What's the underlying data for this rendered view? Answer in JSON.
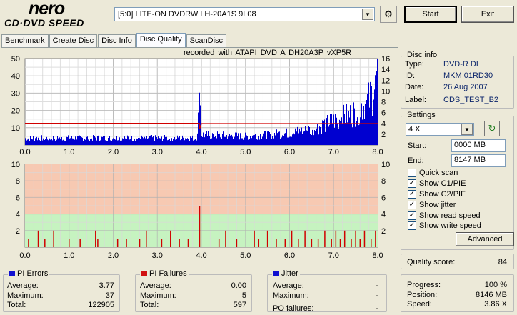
{
  "logo": {
    "brand": "nero",
    "product": "CD·DVD SPEED"
  },
  "drive": {
    "selected": "[5:0]  LITE-ON DVDRW LH-20A1S 9L08"
  },
  "buttons": {
    "start": "Start",
    "exit": "Exit",
    "advanced": "Advanced"
  },
  "tabs": [
    "Benchmark",
    "Create Disc",
    "Disc Info",
    "Disc Quality",
    "ScanDisc"
  ],
  "recorded_info": "recorded with ATAPI   DVD A   DH20A3P   vXP5R",
  "disc_info": {
    "title": "Disc info",
    "rows": [
      {
        "label": "Type:",
        "value": "DVD-R DL"
      },
      {
        "label": "ID:",
        "value": "MKM 01RD30"
      },
      {
        "label": "Date:",
        "value": "26 Aug 2007"
      },
      {
        "label": "Label:",
        "value": "CDS_TEST_B2"
      }
    ]
  },
  "settings": {
    "title": "Settings",
    "speed": "4 X",
    "start_label": "Start:",
    "start_value": "0000 MB",
    "end_label": "End:",
    "end_value": "8147 MB",
    "checks": [
      {
        "label": "Quick scan",
        "checked": false
      },
      {
        "label": "Show C1/PIE",
        "checked": true
      },
      {
        "label": "Show C2/PIF",
        "checked": true
      },
      {
        "label": "Show jitter",
        "checked": true
      },
      {
        "label": "Show read speed",
        "checked": true
      },
      {
        "label": "Show write speed",
        "checked": true
      }
    ]
  },
  "quality": {
    "label": "Quality score:",
    "value": "84"
  },
  "progress": {
    "rows": [
      {
        "label": "Progress:",
        "value": "100 %"
      },
      {
        "label": "Position:",
        "value": "8146 MB"
      },
      {
        "label": "Speed:",
        "value": "3.86 X"
      }
    ]
  },
  "pi_errors": {
    "title": "PI Errors",
    "color": "#1010d0",
    "average_label": "Average:",
    "average": "3.77",
    "maximum_label": "Maximum:",
    "maximum": "37",
    "total_label": "Total:",
    "total": "122905"
  },
  "pi_failures": {
    "title": "PI Failures",
    "color": "#d01010",
    "average_label": "Average:",
    "average": "0.00",
    "maximum_label": "Maximum:",
    "maximum": "5",
    "total_label": "Total:",
    "total": "597"
  },
  "jitter": {
    "title": "Jitter",
    "color": "#1010d0",
    "average_label": "Average:",
    "average": "-",
    "maximum_label": "Maximum:",
    "maximum": "-",
    "po_label": "PO failures:",
    "po": "-"
  },
  "chart_data": [
    {
      "type": "bar",
      "series": [
        {
          "name": "PI Errors",
          "color": "#0000d0"
        },
        {
          "name": "Read speed",
          "color": "#d00000"
        }
      ],
      "x_ticks": [
        "0.0",
        "1.0",
        "2.0",
        "3.0",
        "4.0",
        "5.0",
        "6.0",
        "7.0",
        "8.0"
      ],
      "xlim": [
        0,
        8
      ],
      "y_left_ticks": [
        "10",
        "20",
        "30",
        "40",
        "50"
      ],
      "ylim_left": [
        0,
        50
      ],
      "y_right_ticks": [
        "2",
        "4",
        "6",
        "8",
        "10",
        "12",
        "14",
        "16"
      ],
      "ylim_right": [
        0,
        16
      ],
      "pi_errors_profile": {
        "x": [
          0,
          1,
          2,
          3,
          3.9,
          3.95,
          4.0,
          5,
          6,
          6.5,
          7,
          7.5,
          7.8,
          8.0
        ],
        "y": [
          4,
          4,
          4,
          4,
          4,
          31,
          6,
          5,
          7,
          9,
          14,
          19,
          26,
          36
        ]
      },
      "read_speed": {
        "x": [
          0,
          3.95,
          3.96,
          4.0,
          8.0
        ],
        "y": [
          4,
          4,
          3.0,
          3.96,
          3.96
        ]
      }
    },
    {
      "type": "bar",
      "series": [
        {
          "name": "PI Failures",
          "color": "#d00000"
        }
      ],
      "x_ticks": [
        "0.0",
        "1.0",
        "2.0",
        "3.0",
        "4.0",
        "5.0",
        "6.0",
        "7.0",
        "8.0"
      ],
      "xlim": [
        0,
        8
      ],
      "y_left_ticks": [
        "2",
        "4",
        "6",
        "8",
        "10"
      ],
      "ylim": [
        0,
        10
      ],
      "y_right_ticks": [
        "2",
        "4",
        "6",
        "8",
        "10"
      ],
      "spikes": [
        [
          0.08,
          1
        ],
        [
          0.3,
          2
        ],
        [
          0.45,
          1
        ],
        [
          0.65,
          2
        ],
        [
          1.0,
          1
        ],
        [
          1.25,
          1
        ],
        [
          1.6,
          2
        ],
        [
          1.65,
          1
        ],
        [
          2.1,
          1
        ],
        [
          2.3,
          1
        ],
        [
          2.6,
          1
        ],
        [
          2.75,
          2
        ],
        [
          3.1,
          1
        ],
        [
          3.3,
          2
        ],
        [
          3.5,
          1
        ],
        [
          3.7,
          1
        ],
        [
          3.96,
          5
        ],
        [
          4.4,
          1
        ],
        [
          4.55,
          2
        ],
        [
          4.8,
          1
        ],
        [
          5.2,
          2
        ],
        [
          5.3,
          1
        ],
        [
          5.5,
          2
        ],
        [
          5.7,
          1
        ],
        [
          5.9,
          1
        ],
        [
          6.05,
          2
        ],
        [
          6.2,
          1
        ],
        [
          6.35,
          2
        ],
        [
          6.5,
          1
        ],
        [
          6.65,
          1
        ],
        [
          6.8,
          2
        ],
        [
          6.95,
          1
        ],
        [
          7.05,
          2
        ],
        [
          7.15,
          1
        ],
        [
          7.25,
          2
        ],
        [
          7.4,
          1
        ],
        [
          7.5,
          2
        ],
        [
          7.6,
          1
        ],
        [
          7.7,
          2
        ],
        [
          7.85,
          1
        ],
        [
          7.95,
          2
        ]
      ]
    }
  ]
}
